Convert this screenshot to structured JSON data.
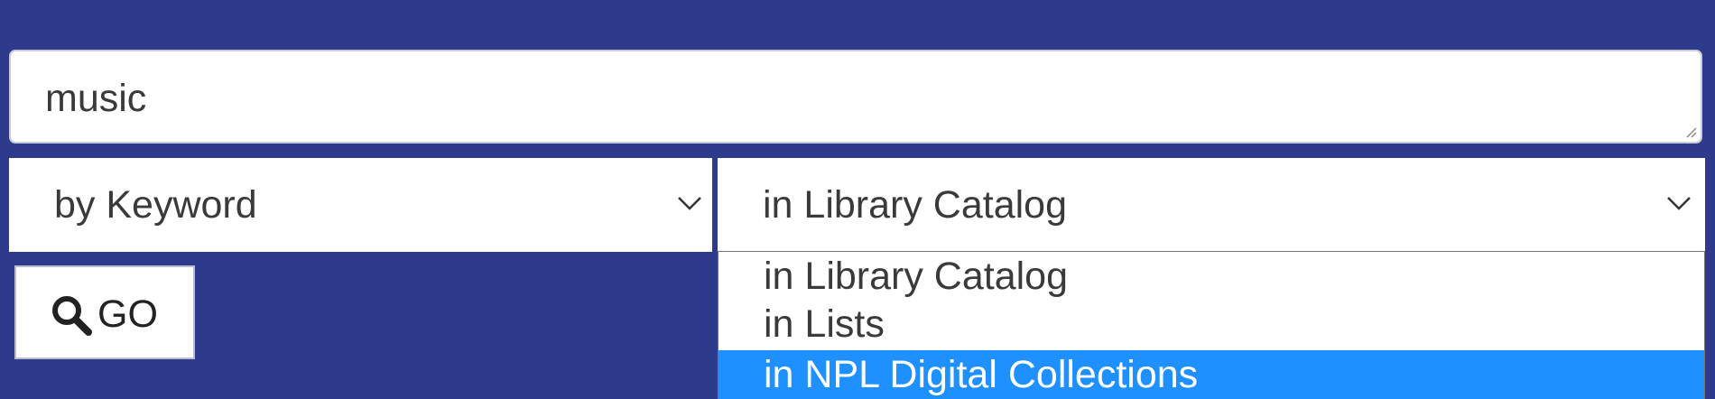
{
  "search": {
    "value": "music"
  },
  "search_type": {
    "selected": "by Keyword"
  },
  "search_scope": {
    "selected": "in Library Catalog",
    "options": [
      "in Library Catalog",
      "in Lists",
      "in NPL Digital Collections"
    ],
    "highlighted_index": 2
  },
  "go_button": {
    "label": "GO",
    "icon": "search-icon"
  },
  "colors": {
    "background": "#2e3a8c",
    "highlight": "#1e90ff"
  }
}
